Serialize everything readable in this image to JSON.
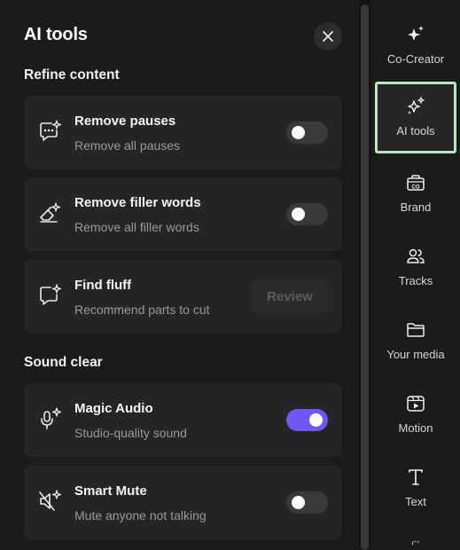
{
  "panel": {
    "title": "AI tools",
    "sections": [
      {
        "title": "Refine content"
      },
      {
        "title": "Sound clear"
      }
    ]
  },
  "cards": [
    {
      "title": "Remove pauses",
      "subtitle": "Remove all pauses",
      "control": "toggle",
      "state": "off"
    },
    {
      "title": "Remove filler words",
      "subtitle": "Remove all filler words",
      "control": "toggle",
      "state": "off"
    },
    {
      "title": "Find fluff",
      "subtitle": "Recommend parts to cut",
      "control": "button",
      "button_label": "Review",
      "button_state": "disabled"
    },
    {
      "title": "Magic Audio",
      "subtitle": "Studio-quality sound",
      "control": "toggle",
      "state": "on"
    },
    {
      "title": "Smart Mute",
      "subtitle": "Mute anyone not talking",
      "control": "toggle",
      "state": "off"
    }
  ],
  "rail": {
    "items": [
      {
        "label": "Co-Creator",
        "icon": "sparkle-icon"
      },
      {
        "label": "AI tools",
        "icon": "sparkles-icon",
        "active": true
      },
      {
        "label": "Brand",
        "icon": "brand-kit-icon"
      },
      {
        "label": "Tracks",
        "icon": "people-icon"
      },
      {
        "label": "Your media",
        "icon": "folder-icon"
      },
      {
        "label": "Motion",
        "icon": "motion-icon"
      },
      {
        "label": "Text",
        "icon": "text-icon"
      }
    ]
  },
  "colors": {
    "accent": "#7155f5",
    "active_outline": "#b8e6c4",
    "panel_bg": "#1b1b1b",
    "card_bg": "#252525"
  }
}
